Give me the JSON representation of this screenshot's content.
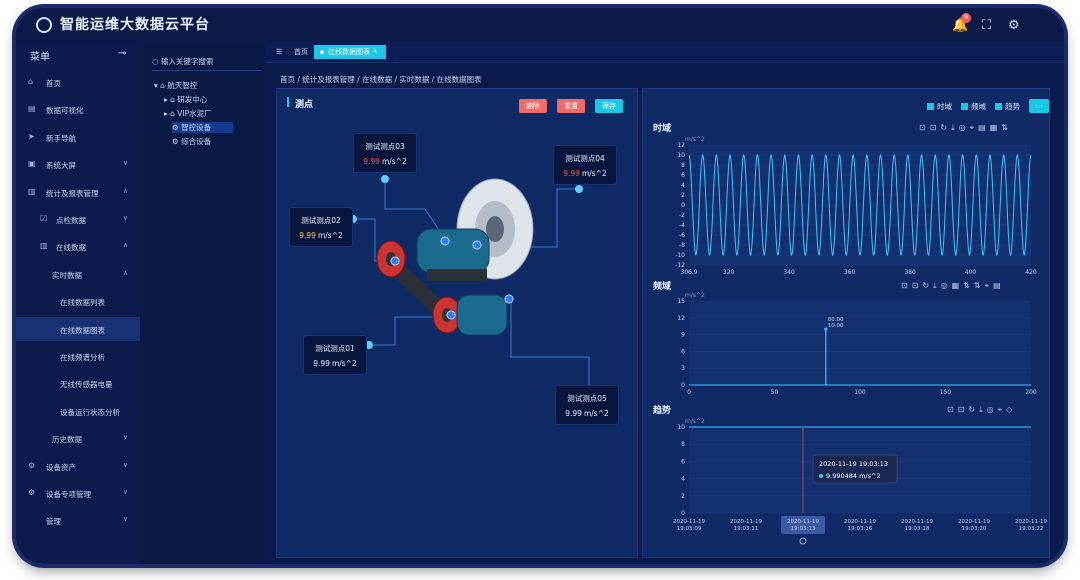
{
  "app": {
    "title": "智能运维大数据云平台",
    "notification_count": "9"
  },
  "sidebar": {
    "heading": "菜单",
    "items": [
      {
        "label": "首页",
        "icon": "home-icon",
        "chevron": ""
      },
      {
        "label": "数据可视化",
        "icon": "chart-icon",
        "chevron": ""
      },
      {
        "label": "新手导航",
        "icon": "send-icon",
        "chevron": ""
      },
      {
        "label": "系统大屏",
        "icon": "screen-icon",
        "chevron": "∨"
      },
      {
        "label": "统计及报表管理",
        "icon": "bar-chart-icon",
        "chevron": "∧"
      },
      {
        "label": "点检数据",
        "icon": "checkbox-icon",
        "chevron": "∨"
      },
      {
        "label": "在线数据",
        "icon": "bar-chart-icon",
        "chevron": "∧"
      },
      {
        "label": "实时数据",
        "icon": "",
        "chevron": "∧"
      },
      {
        "label": "在线数据列表",
        "icon": "",
        "chevron": ""
      },
      {
        "label": "在线数据图表",
        "icon": "",
        "chevron": ""
      },
      {
        "label": "在线频谱分析",
        "icon": "",
        "chevron": ""
      },
      {
        "label": "无线传感器电量",
        "icon": "",
        "chevron": ""
      },
      {
        "label": "设备运行状态分析",
        "icon": "",
        "chevron": ""
      },
      {
        "label": "历史数据",
        "icon": "",
        "chevron": "∨"
      },
      {
        "label": "设备资产",
        "icon": "gear-icon",
        "chevron": "∨"
      },
      {
        "label": "设备专项管理",
        "icon": "settings-icon",
        "chevron": "∨"
      },
      {
        "label": "管理",
        "icon": "",
        "chevron": "∨"
      }
    ]
  },
  "tree": {
    "search_placeholder": "输入关键字搜索",
    "nodes": [
      {
        "label": "航天智控",
        "level": 0
      },
      {
        "label": "研发中心",
        "level": 1
      },
      {
        "label": "VIP水泥厂",
        "level": 1
      },
      {
        "label": "智控设备",
        "level": 2
      },
      {
        "label": "综合设备",
        "level": 2
      }
    ]
  },
  "tabs": [
    {
      "label": "首页"
    },
    {
      "label": "在线数据图表"
    }
  ],
  "breadcrumb": "首页 / 统计及报表管理 / 在线数据 / 实时数据 / 在线数据图表",
  "left_panel": {
    "title": "测点",
    "buttons": [
      {
        "label": "删除",
        "color": "#f06a6a"
      },
      {
        "label": "重置",
        "color": "#f06a6a"
      },
      {
        "label": "保存",
        "color": "#1cc7e6"
      }
    ],
    "points": [
      {
        "name": "测试测点03",
        "value": "9.99",
        "unit": "m/s^2",
        "value_color": "#ff4d4d"
      },
      {
        "name": "测试测点04",
        "value": "9.99",
        "unit": "m/s^2",
        "value_color": "#ff4d4d"
      },
      {
        "name": "测试测点02",
        "value": "9.99",
        "unit": "m/s^2",
        "value_color": "#ffd23f"
      },
      {
        "name": "测试测点01",
        "value": "9.99",
        "unit": "m/s^2",
        "value_color": "#e8f0ff"
      },
      {
        "name": "测试测点05",
        "value": "9.99",
        "unit": "m/s^2",
        "value_color": "#e8f0ff"
      }
    ]
  },
  "right_panel": {
    "checkboxes": [
      {
        "label": "时域"
      },
      {
        "label": "频域"
      },
      {
        "label": "趋势"
      }
    ],
    "more_label": "···"
  },
  "chart_data": [
    {
      "type": "line",
      "title": "时域",
      "ylabel": "m/s^2",
      "xlim": [
        306.9,
        420
      ],
      "ylim": [
        -12,
        12
      ],
      "yticks": [
        -12,
        -10,
        -8,
        -6,
        -4,
        -2,
        0,
        2,
        4,
        6,
        8,
        10,
        12
      ],
      "xticks": [
        "306.9",
        "320",
        "340",
        "360",
        "380",
        "400",
        "420"
      ],
      "xtick_values": [
        306.9,
        320,
        340,
        360,
        380,
        400,
        420
      ],
      "amplitude": 10,
      "cycles": 25,
      "series": [
        {
          "values": []
        }
      ]
    },
    {
      "type": "line",
      "title": "频域",
      "ylabel": "m/s^2",
      "xlim": [
        0,
        200
      ],
      "ylim": [
        0,
        15
      ],
      "yticks": [
        0,
        3,
        6,
        9,
        12,
        15
      ],
      "xticks": [
        "0",
        "50",
        "100",
        "150",
        "200"
      ],
      "xtick_values": [
        0,
        50,
        100,
        150,
        200
      ],
      "peak": {
        "x": 80,
        "y": 10,
        "label_x": "80.00",
        "label_y": "10.00"
      }
    },
    {
      "type": "line",
      "title": "趋势",
      "ylabel": "m/s^2",
      "ylim": [
        0,
        10
      ],
      "yticks": [
        0,
        2,
        4,
        6,
        8,
        10
      ],
      "xticks": [
        {
          "date": "2020-11-19",
          "time": "19:03:09"
        },
        {
          "date": "2020-11-19",
          "time": "19:03:11"
        },
        {
          "date": "2020-11-19",
          "time": "19:03:13"
        },
        {
          "date": "2020-11-19",
          "time": "19:03:16"
        },
        {
          "date": "2020-11-19",
          "time": "19:03:18"
        },
        {
          "date": "2020-11-19",
          "time": "19:03:20"
        },
        {
          "date": "2020-11-19",
          "time": "19:03:22"
        }
      ],
      "series": [
        {
          "values": [
            10,
            10,
            10,
            10,
            10,
            10,
            10
          ]
        }
      ],
      "tooltip": {
        "time": "2020-11-19 19:03:13",
        "value": "9.990484 m/s^2"
      }
    }
  ],
  "colors": {
    "accent": "#1cc7e6",
    "danger": "#f06a6a",
    "line": "#3fc5ff"
  }
}
